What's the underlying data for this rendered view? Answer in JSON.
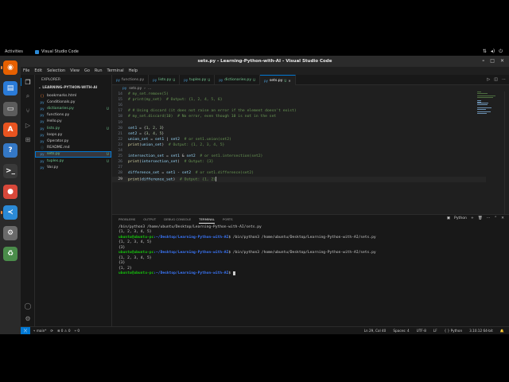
{
  "topbar": {
    "activities": "Activities",
    "app_name": "Visual Studio Code",
    "clock": "",
    "tray": [
      "network-icon",
      "volume-icon",
      "power-icon"
    ]
  },
  "dock": {
    "apps": [
      {
        "name": "firefox",
        "color": "#e66000",
        "glyph": "◉"
      },
      {
        "name": "libreoffice-writer",
        "color": "#2a7bd8",
        "glyph": "▤"
      },
      {
        "name": "files",
        "color": "#5c5c5c",
        "glyph": "▭"
      },
      {
        "name": "software-center",
        "color": "#e95420",
        "glyph": "A"
      },
      {
        "name": "help",
        "color": "#3478c6",
        "glyph": "?"
      },
      {
        "name": "terminal",
        "color": "#3a3a3a",
        "glyph": ">_"
      },
      {
        "name": "chrome",
        "color": "#d8483a",
        "glyph": "●"
      },
      {
        "name": "vscode",
        "color": "#2b8ad6",
        "glyph": "≺"
      },
      {
        "name": "settings",
        "color": "#6a6a6a",
        "glyph": "⚙"
      },
      {
        "name": "trash",
        "color": "#4a8c4a",
        "glyph": "♻"
      }
    ]
  },
  "window": {
    "title": "sets.py - Learning-Python-with-AI - Visual Studio Code",
    "controls": [
      "–",
      "□",
      "✕"
    ]
  },
  "menubar": [
    "File",
    "Edit",
    "Selection",
    "View",
    "Go",
    "Run",
    "Terminal",
    "Help"
  ],
  "sidebar": {
    "header": "EXPLORER",
    "folder": "LEARNING-PYTHON-WITH-AI",
    "files": [
      {
        "icon": "{}",
        "name": "bookmarks.html",
        "mod": "",
        "color": "#e37933"
      },
      {
        "icon": "py",
        "name": "Conditionals.py",
        "mod": "",
        "color": "#4b9cd3"
      },
      {
        "icon": "py",
        "name": "dictionaries.py",
        "mod": "U",
        "color": "#4b9cd3"
      },
      {
        "icon": "py",
        "name": "functions.py",
        "mod": "",
        "color": "#4b9cd3"
      },
      {
        "icon": "py",
        "name": "Hello.py",
        "mod": "",
        "color": "#4b9cd3"
      },
      {
        "icon": "py",
        "name": "lists.py",
        "mod": "U",
        "color": "#4b9cd3"
      },
      {
        "icon": "py",
        "name": "loops.py",
        "mod": "",
        "color": "#4b9cd3"
      },
      {
        "icon": "py",
        "name": "Operator.py",
        "mod": "",
        "color": "#4b9cd3"
      },
      {
        "icon": "ⓘ",
        "name": "README.md",
        "mod": "",
        "color": "#519aba"
      },
      {
        "icon": "py",
        "name": "sets.py",
        "mod": "U",
        "color": "#4b9cd3",
        "selected": true
      },
      {
        "icon": "py",
        "name": "tuples.py",
        "mod": "U",
        "color": "#4b9cd3"
      },
      {
        "icon": "py",
        "name": "Var.py",
        "mod": "",
        "color": "#4b9cd3"
      }
    ],
    "sections": [
      "OUTLINE",
      "TIMELINE"
    ]
  },
  "tabs": [
    {
      "name": "functions.py",
      "mod": "",
      "active": false
    },
    {
      "name": "lists.py",
      "mod": "U",
      "active": false
    },
    {
      "name": "tuples.py",
      "mod": "U",
      "active": false
    },
    {
      "name": "dictionaries.py",
      "mod": "U",
      "active": false
    },
    {
      "name": "sets.py",
      "mod": "U",
      "active": true
    }
  ],
  "breadcrumb": [
    "sets.py",
    "..."
  ],
  "editor": {
    "lines": [
      {
        "n": "14",
        "parts": [
          [
            "c-cmt",
            "# my_set.remove(5)"
          ]
        ]
      },
      {
        "n": "15",
        "parts": [
          [
            "c-cmt",
            "# print(my_set)  # Output: {1, 2, 4, 5, 6}"
          ]
        ]
      },
      {
        "n": "16",
        "parts": []
      },
      {
        "n": "17",
        "parts": [
          [
            "c-cmt",
            "# # Using discard (it does not raise an error if the element doesn't exist)"
          ]
        ]
      },
      {
        "n": "18",
        "parts": [
          [
            "c-cmt",
            "# my_set.discard(10)  # No error, even though 10 is not in the set"
          ]
        ]
      },
      {
        "n": "19",
        "parts": []
      },
      {
        "n": "20",
        "parts": [
          [
            "c-var",
            "set1"
          ],
          [
            "c-op",
            " = {"
          ],
          [
            "c-num",
            "1"
          ],
          [
            "c-op",
            ", "
          ],
          [
            "c-num",
            "2"
          ],
          [
            "c-op",
            ", "
          ],
          [
            "c-num",
            "3"
          ],
          [
            "c-op",
            "}"
          ]
        ]
      },
      {
        "n": "21",
        "parts": [
          [
            "c-var",
            "set2"
          ],
          [
            "c-op",
            " = {"
          ],
          [
            "c-num",
            "3"
          ],
          [
            "c-op",
            ", "
          ],
          [
            "c-num",
            "4"
          ],
          [
            "c-op",
            ", "
          ],
          [
            "c-num",
            "5"
          ],
          [
            "c-op",
            "}"
          ]
        ]
      },
      {
        "n": "22",
        "parts": [
          [
            "c-var",
            "union_set"
          ],
          [
            "c-op",
            " = "
          ],
          [
            "c-var",
            "set1"
          ],
          [
            "c-op",
            " | "
          ],
          [
            "c-var",
            "set2"
          ],
          [
            "c-op",
            "  "
          ],
          [
            "c-cmt",
            "# or set1.union(set2)"
          ]
        ]
      },
      {
        "n": "23",
        "parts": [
          [
            "c-fn",
            "print"
          ],
          [
            "c-op",
            "("
          ],
          [
            "c-var",
            "union_set"
          ],
          [
            "c-op",
            ")  "
          ],
          [
            "c-cmt",
            "# Output: {1, 2, 3, 4, 5}"
          ]
        ]
      },
      {
        "n": "24",
        "parts": []
      },
      {
        "n": "25",
        "parts": [
          [
            "c-var",
            "intersection_set"
          ],
          [
            "c-op",
            " = "
          ],
          [
            "c-var",
            "set1"
          ],
          [
            "c-op",
            " & "
          ],
          [
            "c-var",
            "set2"
          ],
          [
            "c-op",
            "  "
          ],
          [
            "c-cmt",
            "# or set1.intersection(set2)"
          ]
        ]
      },
      {
        "n": "26",
        "parts": [
          [
            "c-fn",
            "print"
          ],
          [
            "c-op",
            "("
          ],
          [
            "c-var",
            "intersection_set"
          ],
          [
            "c-op",
            ")  "
          ],
          [
            "c-cmt",
            "# Output: {3}"
          ]
        ]
      },
      {
        "n": "27",
        "parts": []
      },
      {
        "n": "28",
        "parts": [
          [
            "c-var",
            "difference_set"
          ],
          [
            "c-op",
            " = "
          ],
          [
            "c-var",
            "set1"
          ],
          [
            "c-op",
            " - "
          ],
          [
            "c-var",
            "set2"
          ],
          [
            "c-op",
            "  "
          ],
          [
            "c-cmt",
            "# or set1.difference(set2)"
          ]
        ]
      },
      {
        "n": "29",
        "parts": [
          [
            "c-fn",
            "print"
          ],
          [
            "c-op",
            "("
          ],
          [
            "c-var",
            "difference_set"
          ],
          [
            "c-op",
            ")  "
          ],
          [
            "c-cmt",
            "# Output: {1, 2}"
          ]
        ],
        "current": true
      }
    ]
  },
  "panel": {
    "tabs": [
      "PROBLEMS",
      "OUTPUT",
      "DEBUG CONSOLE",
      "TERMINAL",
      "PORTS"
    ],
    "active_tab": "TERMINAL",
    "terminal_name": "Python",
    "terminal": [
      {
        "type": "out",
        "text": "/bin/python3 /home/ubuntu/Desktop/Learning-Python-with-AI/sets.py"
      },
      {
        "type": "out",
        "text": "{1, 2, 3, 4, 5}"
      },
      {
        "type": "prompt",
        "user": "ubuntu@ubuntu-pc",
        "path": ":~/Desktop/Learning-Python-with-AI",
        "cmd": "$ /bin/python3 /home/ubuntu/Desktop/Learning-Python-with-AI/sets.py"
      },
      {
        "type": "out",
        "text": "{1, 2, 3, 4, 5}"
      },
      {
        "type": "out",
        "text": "{3}"
      },
      {
        "type": "prompt",
        "user": "ubuntu@ubuntu-pc",
        "path": ":~/Desktop/Learning-Python-with-AI",
        "cmd": "$ /bin/python3 /home/ubuntu/Desktop/Learning-Python-with-AI/sets.py"
      },
      {
        "type": "out",
        "text": "{1, 2, 3, 4, 5}"
      },
      {
        "type": "out",
        "text": "{3}"
      },
      {
        "type": "out",
        "text": "{1, 2}"
      },
      {
        "type": "prompt",
        "user": "ubuntu@ubuntu-pc",
        "path": ":~/Desktop/Learning-Python-with-AI",
        "cmd": "$ ",
        "cursor": true
      }
    ]
  },
  "statusbar": {
    "branch": "main*",
    "sync": "⟳",
    "problems": "⊗ 0 ⚠ 0",
    "ports": "⑂ 0",
    "position": "Ln 29, Col 40",
    "spaces": "Spaces: 4",
    "encoding": "UTF-8",
    "eol": "LF",
    "language": "{ } Python",
    "interpreter": "3.10.12 64-bit"
  }
}
